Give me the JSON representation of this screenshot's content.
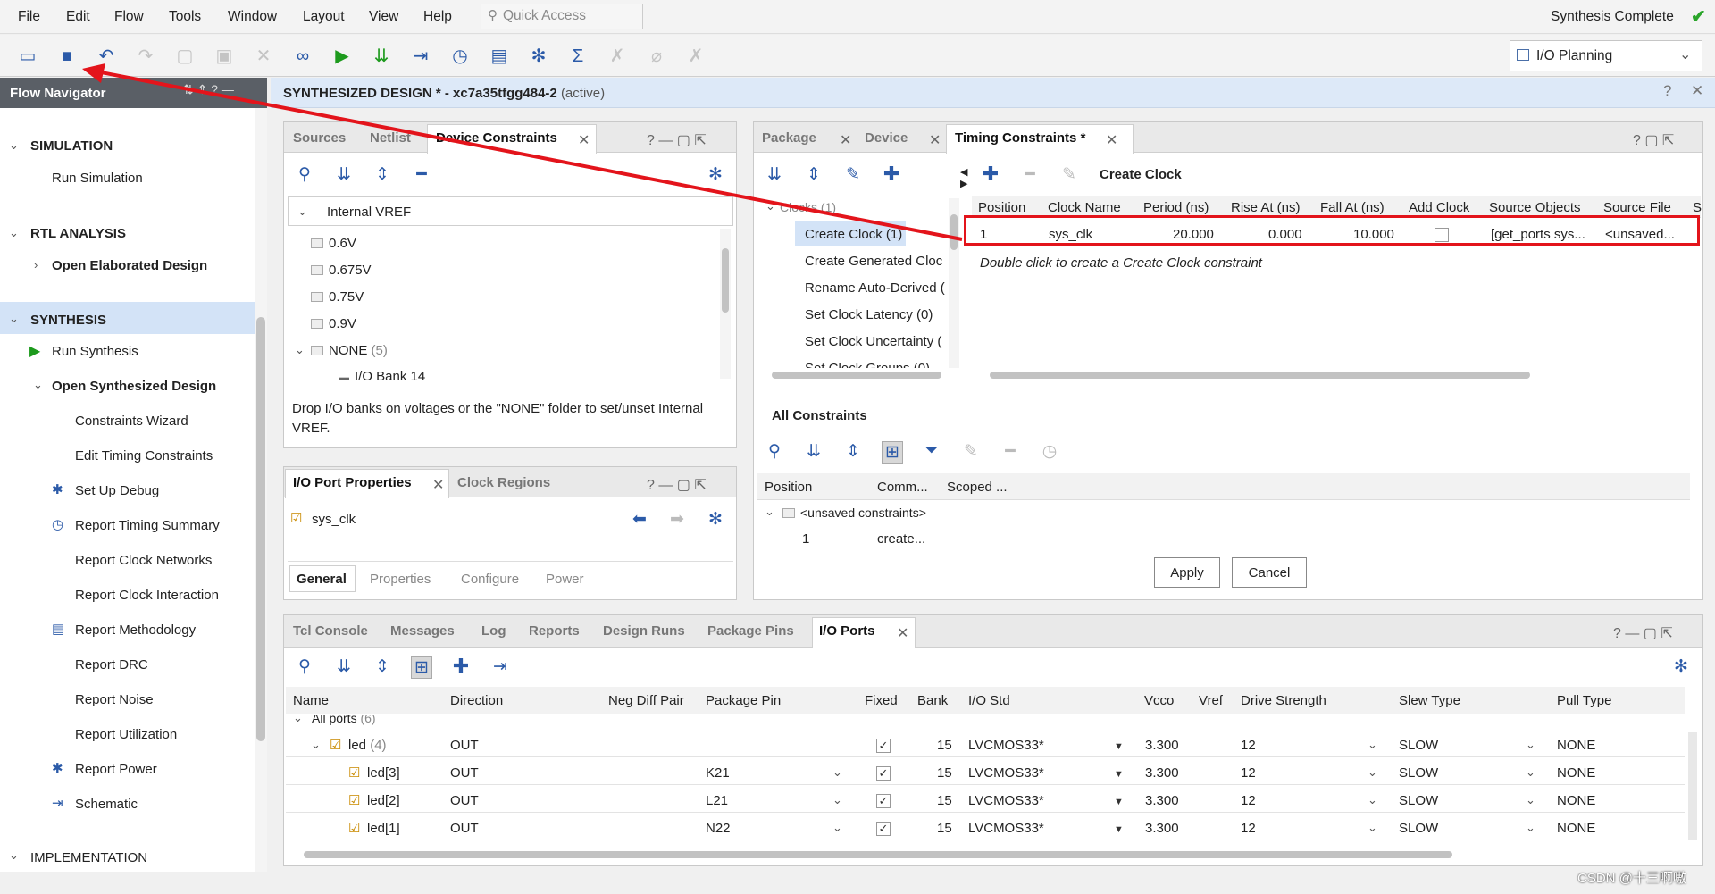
{
  "menu": {
    "items": [
      "File",
      "Edit",
      "Flow",
      "Tools",
      "Window",
      "Layout",
      "View",
      "Help"
    ],
    "quick_access_placeholder": "Quick Access",
    "status": "Synthesis Complete"
  },
  "toolbar": {
    "layout": "I/O Planning",
    "icons": [
      "open-project-icon",
      "save-icon",
      "undo-icon",
      "redo-icon",
      "copy-icon",
      "paste-icon",
      "delete-icon",
      "find-icon",
      "run-icon",
      "program-icon",
      "implement-icon",
      "timer-icon",
      "report-icon",
      "settings-icon",
      "sum-icon",
      "disabled-1-icon",
      "disabled-2-icon",
      "disabled-3-icon"
    ]
  },
  "flow_navigator": {
    "title": "Flow Navigator",
    "simulation": "SIMULATION",
    "run_simulation": "Run Simulation",
    "rtl": "RTL ANALYSIS",
    "open_elaborated": "Open Elaborated Design",
    "synthesis": "SYNTHESIS",
    "run_synthesis": "Run Synthesis",
    "open_synth": "Open Synthesized Design",
    "items": [
      "Constraints Wizard",
      "Edit Timing Constraints",
      "Set Up Debug",
      "Report Timing Summary",
      "Report Clock Networks",
      "Report Clock Interaction",
      "Report Methodology",
      "Report DRC",
      "Report Noise",
      "Report Utilization",
      "Report Power",
      "Schematic"
    ],
    "implementation": "IMPLEMENTATION"
  },
  "design": {
    "title": "SYNTHESIZED DESIGN * - xc7a35tfgg484-2",
    "active": "(active)"
  },
  "sources_panel": {
    "tabs": [
      "Sources",
      "Netlist",
      "Device Constraints"
    ],
    "root": "Internal VREF",
    "items": [
      "0.6V",
      "0.675V",
      "0.75V",
      "0.9V"
    ],
    "none_label": "NONE",
    "none_count": "(5)",
    "bank": "I/O Bank 14",
    "hint": "Drop I/O banks on voltages or the \"NONE\" folder to set/unset Internal VREF."
  },
  "props_panel": {
    "tabs": [
      "I/O Port Properties",
      "Clock Regions"
    ],
    "port": "sys_clk",
    "subtabs": [
      "General",
      "Properties",
      "Configure",
      "Power"
    ]
  },
  "timing_panel": {
    "tabs": [
      "Package",
      "Device",
      "Timing Constraints *"
    ],
    "clocks_label": "Clocks",
    "clocks_count": "(1)",
    "tree": [
      "Create Clock (1)",
      "Create Generated Cloc",
      "Rename Auto-Derived (",
      "Set Clock Latency (0)",
      "Set Clock Uncertainty (",
      "Set Clock Groups (0)"
    ],
    "create_clock_label": "Create Clock",
    "columns": [
      "Position",
      "Clock Name",
      "Period (ns)",
      "Rise At (ns)",
      "Fall At (ns)",
      "Add Clock",
      "Source Objects",
      "Source File",
      "S"
    ],
    "row": {
      "position": "1",
      "clock_name": "sys_clk",
      "period": "20.000",
      "rise": "0.000",
      "fall": "10.000",
      "source_objects": "[get_ports sys...",
      "source_file": "<unsaved..."
    },
    "hint": "Double click to create a Create Clock constraint",
    "all_constraints": "All Constraints",
    "ac_columns": [
      "Position",
      "Comm...",
      "Scoped ..."
    ],
    "unsaved": "<unsaved constraints>",
    "ac_row": {
      "position": "1",
      "command": "create..."
    },
    "apply": "Apply",
    "cancel": "Cancel"
  },
  "bottom_panel": {
    "tabs": [
      "Tcl Console",
      "Messages",
      "Log",
      "Reports",
      "Design Runs",
      "Package Pins",
      "I/O Ports"
    ],
    "columns": [
      "Name",
      "Direction",
      "Neg Diff Pair",
      "Package Pin",
      "Fixed",
      "Bank",
      "I/O Std",
      "Vcco",
      "Vref",
      "Drive Strength",
      "Slew Type",
      "Pull Type"
    ],
    "all_ports": "All ports",
    "all_ports_count": "(6)",
    "led_group": "led",
    "led_count": "(4)",
    "rows": [
      {
        "name": "led",
        "direction": "OUT",
        "pin": "",
        "bank": "15",
        "iostd": "LVCMOS33*",
        "vcco": "3.300",
        "drive": "12",
        "slew": "SLOW",
        "pull": "NONE"
      },
      {
        "name": "led[3]",
        "direction": "OUT",
        "pin": "K21",
        "bank": "15",
        "iostd": "LVCMOS33*",
        "vcco": "3.300",
        "drive": "12",
        "slew": "SLOW",
        "pull": "NONE"
      },
      {
        "name": "led[2]",
        "direction": "OUT",
        "pin": "L21",
        "bank": "15",
        "iostd": "LVCMOS33*",
        "vcco": "3.300",
        "drive": "12",
        "slew": "SLOW",
        "pull": "NONE"
      },
      {
        "name": "led[1]",
        "direction": "OUT",
        "pin": "N22",
        "bank": "15",
        "iostd": "LVCMOS33*",
        "vcco": "3.300",
        "drive": "12",
        "slew": "SLOW",
        "pull": "NONE"
      }
    ]
  },
  "watermark": "CSDN @十三啊嗷",
  "colors": {
    "accent": "#2b5aa8",
    "annotation": "#e3141b",
    "selection": "#d3e3f7",
    "header": "#5a5f66"
  }
}
